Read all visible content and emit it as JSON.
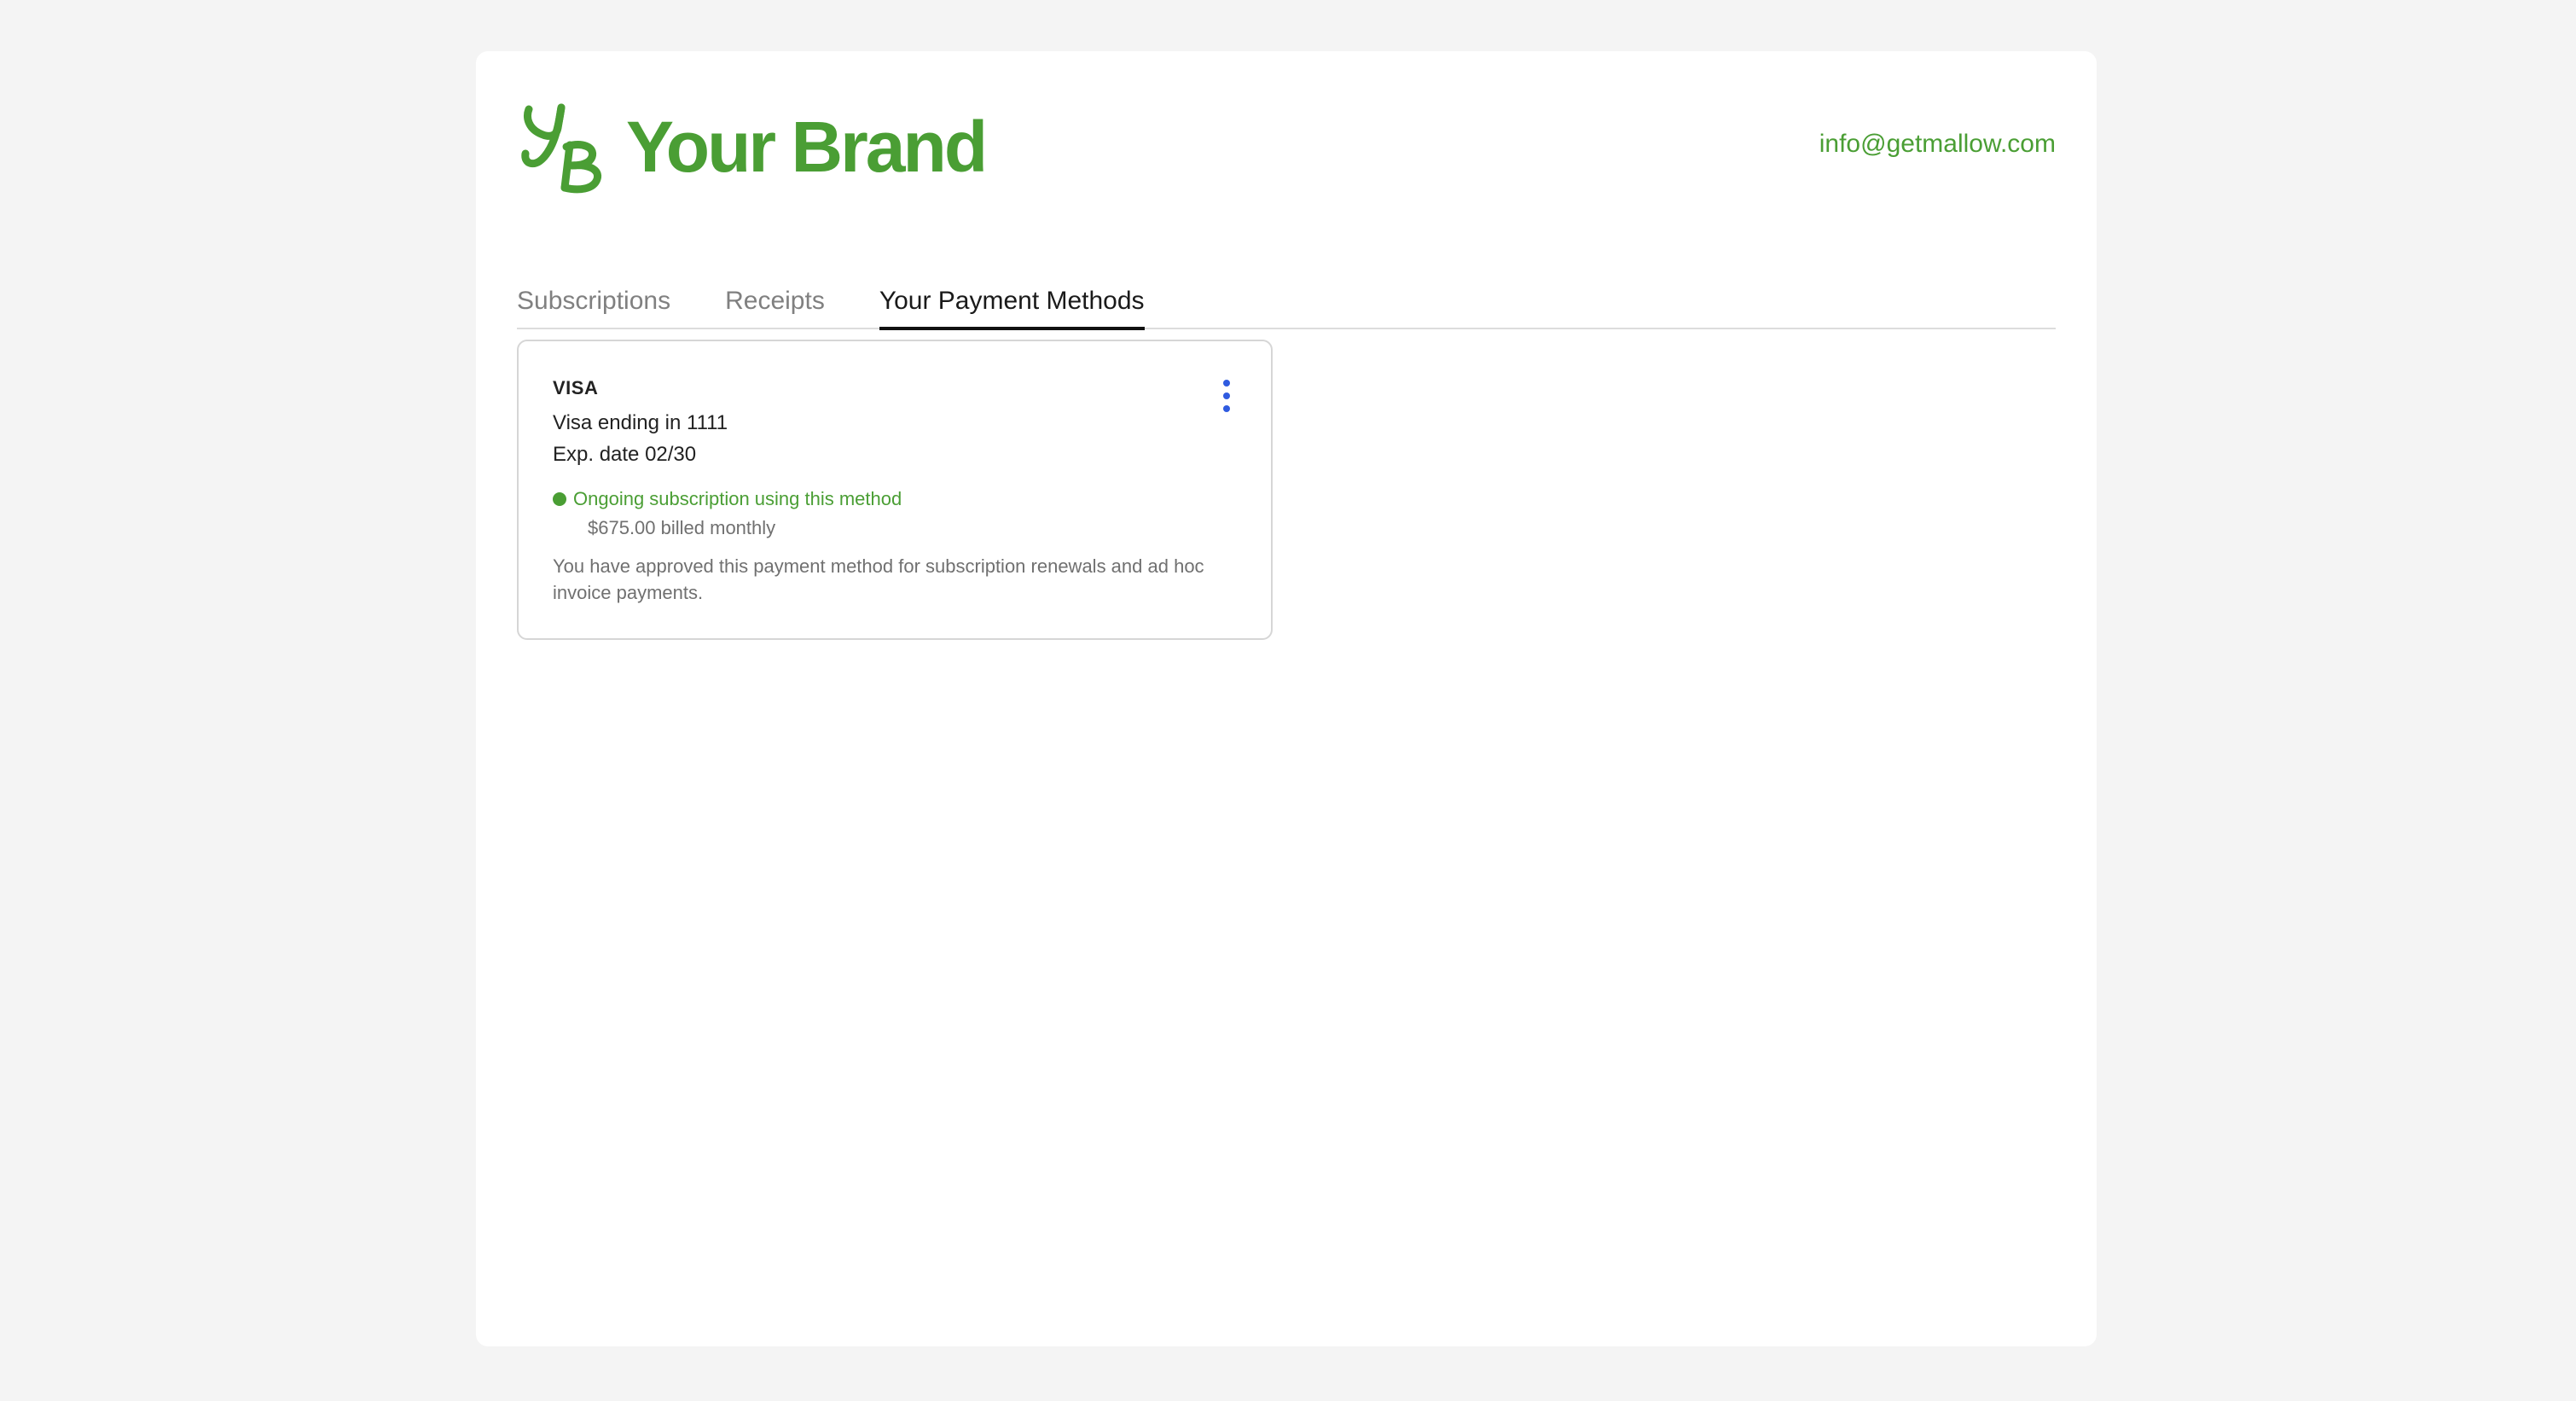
{
  "brand": {
    "name": "Your Brand",
    "monogram": "YB",
    "color": "#4a9e34"
  },
  "header": {
    "email": "info@getmallow.com"
  },
  "tabs": [
    {
      "label": "Subscriptions",
      "active": false
    },
    {
      "label": "Receipts",
      "active": false
    },
    {
      "label": "Your Payment Methods",
      "active": true
    }
  ],
  "payment_methods": [
    {
      "brand_label": "VISA",
      "description": "Visa ending in 1111",
      "expiry": "Exp. date 02/30",
      "status": "Ongoing subscription using this method",
      "billing": "$675.00 billed monthly",
      "note": "You have approved this payment method for subscription renewals and ad hoc invoice payments.",
      "menu_icon": "kebab-menu-icon",
      "menu_icon_color": "#2f5be0"
    }
  ]
}
